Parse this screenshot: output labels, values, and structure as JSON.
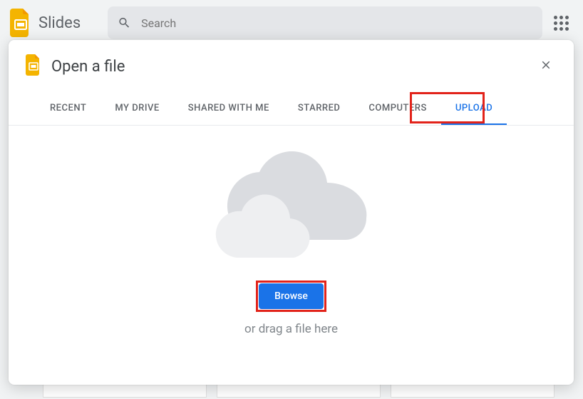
{
  "header": {
    "app_name": "Slides",
    "search_placeholder": "Search"
  },
  "modal": {
    "title": "Open a file",
    "tabs": {
      "recent": "RECENT",
      "my_drive": "MY DRIVE",
      "shared": "SHARED WITH ME",
      "starred": "STARRED",
      "computers": "COMPUTERS",
      "upload": "UPLOAD"
    },
    "browse_label": "Browse",
    "drag_text": "or drag a file here"
  }
}
